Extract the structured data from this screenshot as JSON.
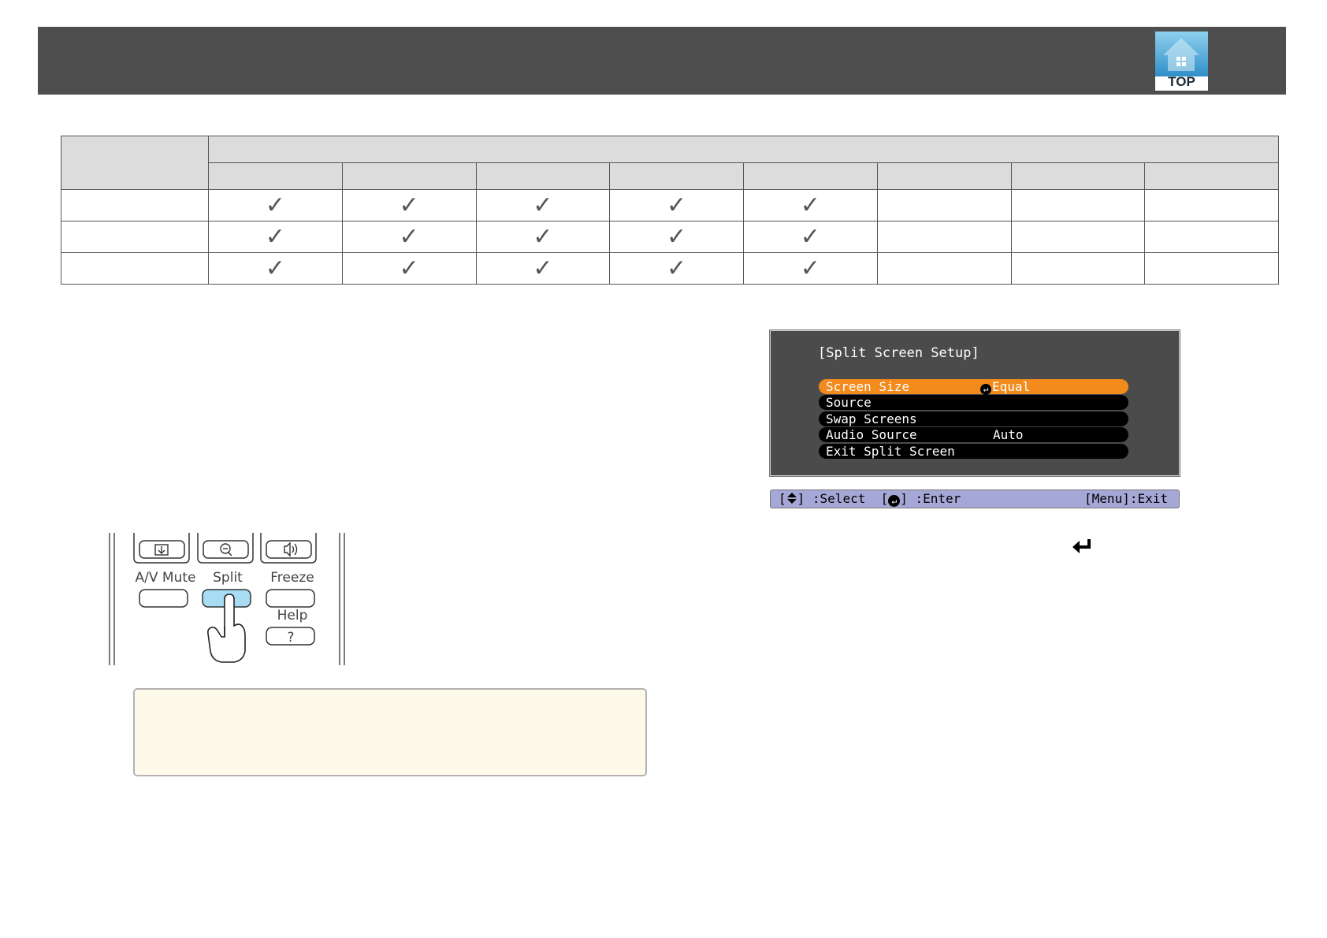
{
  "header": {
    "top_button": "TOP"
  },
  "compat_table": {
    "column_count": 8,
    "rows": [
      {
        "marks": [
          "✓",
          "✓",
          "✓",
          "✓",
          "✓",
          "",
          "",
          ""
        ]
      },
      {
        "marks": [
          "✓",
          "✓",
          "✓",
          "✓",
          "✓",
          "",
          "",
          ""
        ]
      },
      {
        "marks": [
          "✓",
          "✓",
          "✓",
          "✓",
          "✓",
          "",
          "",
          ""
        ]
      }
    ]
  },
  "osd": {
    "title": "[Split Screen Setup]",
    "items": [
      {
        "label": "Screen Size",
        "value": "Equal",
        "selected": true,
        "enter_icon": "↵"
      },
      {
        "label": "Source",
        "value": ""
      },
      {
        "label": "Swap Screens",
        "value": ""
      },
      {
        "label": "Audio Source",
        "value": "Auto"
      },
      {
        "label": "Exit Split Screen",
        "value": ""
      }
    ],
    "guide": {
      "select_open": "[",
      "select_close": "] :Select",
      "enter_open": "[",
      "enter_close": "] :Enter",
      "exit": "[Menu]:Exit"
    }
  },
  "remote": {
    "av_mute": "A/V Mute",
    "split": "Split",
    "freeze": "Freeze",
    "help": "Help",
    "help_symbol": "?"
  },
  "colors": {
    "header_bar": "#4e4e4e",
    "osd_bg": "#4b4b4b",
    "osd_selected": "#f28a1c",
    "osd_guide": "#a5a7d6",
    "split_button": "#a8dcf4",
    "note_bg": "#fefaea"
  },
  "icons": [
    "home-icon",
    "return-arrow-icon",
    "hand-pointer-icon",
    "source-search-icon",
    "zoom-out-icon",
    "volume-icon",
    "updown-arrow-icon",
    "enter-icon"
  ]
}
